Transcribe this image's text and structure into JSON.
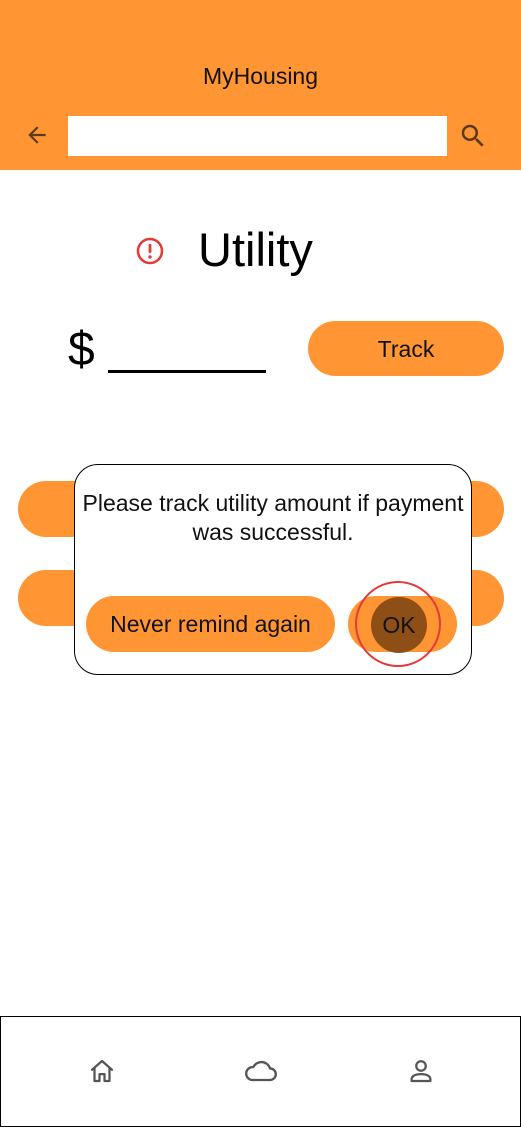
{
  "header": {
    "title": "MyHousing",
    "back_icon": "arrow-back-icon",
    "search_icon": "search-icon",
    "search_value": ""
  },
  "page": {
    "title": "Utility",
    "alert_icon": "alert-circle-icon",
    "currency_symbol": "$",
    "track_label": "Track"
  },
  "dialog": {
    "message": "Please track utility amount if payment was successful.",
    "never_label": "Never remind again",
    "ok_label": "OK"
  },
  "bottom_nav": {
    "items": [
      {
        "icon": "home-icon"
      },
      {
        "icon": "cloud-icon"
      },
      {
        "icon": "person-icon"
      }
    ]
  },
  "colors": {
    "accent": "#ff9533",
    "ok_pressed": "#8e4f17",
    "highlight_ring": "#e53935",
    "alert": "#e53935"
  }
}
